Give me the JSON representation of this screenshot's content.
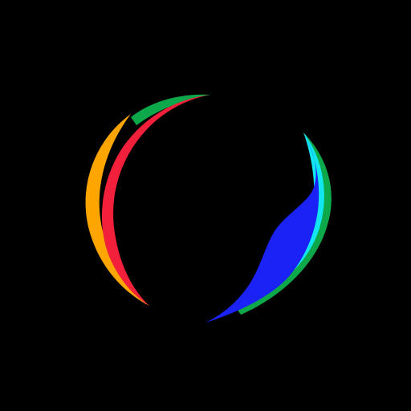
{
  "logo": {
    "icon": "swoosh-circle-logo-icon",
    "background_color": "#000000",
    "colors": {
      "green": "#0da84a",
      "orange": "#ffa500",
      "red": "#f2203a",
      "cyan": "#12e6f0",
      "blue": "#1a22f5"
    }
  }
}
